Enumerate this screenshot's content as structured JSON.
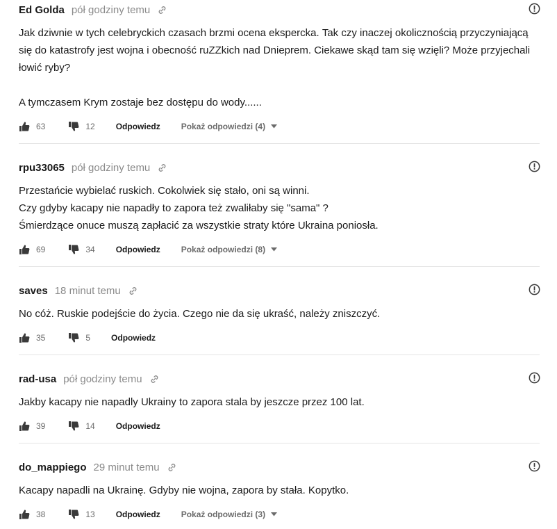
{
  "comments": [
    {
      "author": "Ed Golda",
      "time": "pół godziny temu",
      "body": [
        "Jak dziwnie w tych celebryckich czasach brzmi ocena eksperckа. Tak czy inaczej okolicznością przyczyniającą się do katastrofy jest wojna i obecność ruZZkich nad Dnieprem. Ciekawe skąd tam się wzięli? Może przyjechali łowić ryby?",
        "",
        "A tymczasem Krym zostaje bez dostępu do wody......"
      ],
      "likes": "63",
      "dislikes": "12",
      "reply_label": "Odpowiedz",
      "show_replies_label": "Pokaż odpowiedzi (4)"
    },
    {
      "author": "rpu33065",
      "time": "pół godziny temu",
      "body": [
        "Przestańcie wybielać ruskich. Cokolwiek się stało, oni są winni.",
        "Czy gdyby kacapy nie napadły to zapora też zwaliłaby się \"sama\" ?",
        "Śmierdzące onuce muszą zapłacić za wszystkie straty które Ukraina poniosła."
      ],
      "likes": "69",
      "dislikes": "34",
      "reply_label": "Odpowiedz",
      "show_replies_label": "Pokaż odpowiedzi (8)"
    },
    {
      "author": "saves",
      "time": "18 minut temu",
      "body": [
        "No cóż. Ruskie podejście do życia. Czego nie da się ukraść, należy zniszczyć."
      ],
      "likes": "35",
      "dislikes": "5",
      "reply_label": "Odpowiedz",
      "show_replies_label": ""
    },
    {
      "author": "rad-usa",
      "time": "pół godziny temu",
      "body": [
        "Jakby kacapy nie napadly Ukrainy to zapora stala by jeszcze przez 100 lat."
      ],
      "likes": "39",
      "dislikes": "14",
      "reply_label": "Odpowiedz",
      "show_replies_label": ""
    },
    {
      "author": "do_mappiego",
      "time": "29 minut temu",
      "body": [
        "Kacapy napadli na Ukrainę. Gdyby nie wojna, zapora by stała. Kopytko."
      ],
      "likes": "38",
      "dislikes": "13",
      "reply_label": "Odpowiedz",
      "show_replies_label": "Pokaż odpowiedzi (3)"
    }
  ]
}
